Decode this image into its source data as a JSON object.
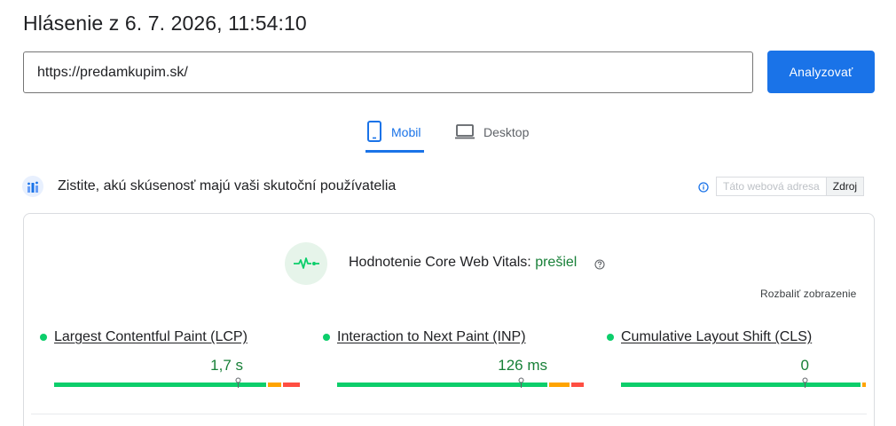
{
  "header": {
    "title": "Hlásenie z 6. 7. 2026, 11:54:10"
  },
  "url_bar": {
    "value": "https://predamkupim.sk/",
    "analyze_label": "Analyzovať"
  },
  "tabs": [
    {
      "label": "Mobil",
      "icon": "smartphone-icon",
      "active": true
    },
    {
      "label": "Desktop",
      "icon": "laptop-icon",
      "active": false
    }
  ],
  "crux": {
    "title": "Zistite, akú skúsenosť majú vaši skutoční používatelia",
    "toggle": {
      "url_label": "Táto webová adresa",
      "origin_label": "Zdroj",
      "selected": "Zdroj"
    }
  },
  "assessment": {
    "label": "Hodnotenie Core Web Vitals:",
    "status": "prešiel",
    "expand_label": "Rozbaliť zobrazenie"
  },
  "metrics": [
    {
      "name": "Largest Contentful Paint (LCP)",
      "value": "1,7 s",
      "status": "good",
      "distribution": {
        "good": 0.87,
        "needs_improvement": 0.06,
        "poor": 0.07
      }
    },
    {
      "name": "Interaction to Next Paint (INP)",
      "value": "126 ms",
      "status": "good",
      "distribution": {
        "good": 0.86,
        "needs_improvement": 0.09,
        "poor": 0.05
      }
    },
    {
      "name": "Cumulative Layout Shift (CLS)",
      "value": "0",
      "status": "good",
      "distribution": {
        "good": 0.985,
        "needs_improvement": 0.015,
        "poor": 0
      }
    }
  ],
  "colors": {
    "accent": "#1a73e8",
    "good": "#0cce6b",
    "needs_improvement": "#ffa400",
    "poor": "#ff4e42",
    "pass_text": "#188038"
  }
}
